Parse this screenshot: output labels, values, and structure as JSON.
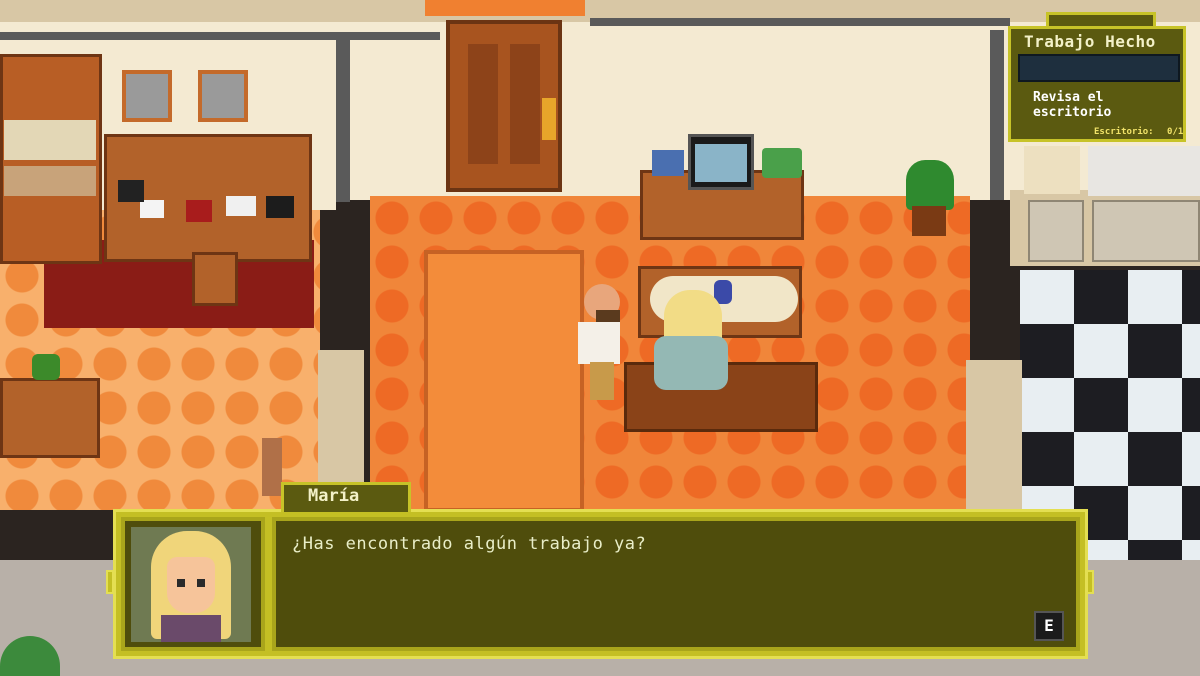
{
  "quest": {
    "title": "Trabajo Hecho",
    "task": "Revisa el escritorio",
    "progress_label": "Escritorio:",
    "progress_count": "0/1"
  },
  "dialog": {
    "speaker": "María",
    "text": "¿Has encontrado algún trabajo ya?",
    "continue_key": "E"
  },
  "colors": {
    "ui_frame": "#c4bf24",
    "ui_panel": "#4f4d0c",
    "floor_orange": "#f0863a",
    "floor_tile": "#ee6a25"
  }
}
